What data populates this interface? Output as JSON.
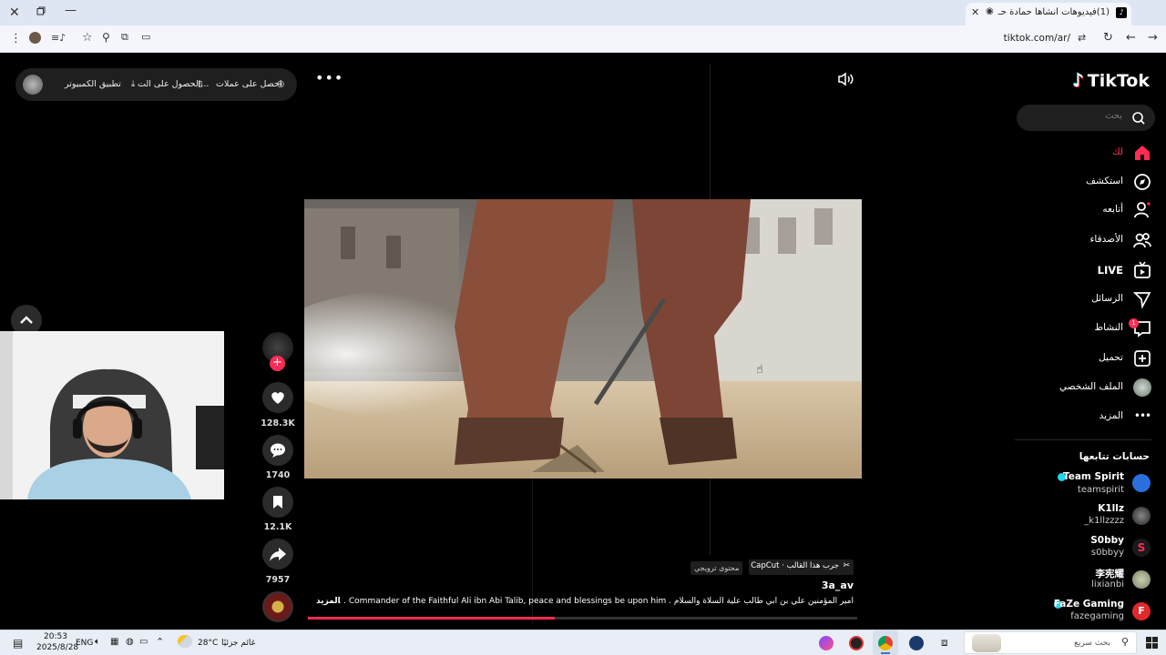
{
  "browser": {
    "tab_title": "(1)فيديوهات أنشأها حمادة حـ",
    "url": "tiktok.com/ar/"
  },
  "top_pill": {
    "coins_label": "احصل على عملات",
    "get_app_label": "الحصول على الت...",
    "desktop_app_label": "تطبيق الكمبيوتر"
  },
  "brand": {
    "name": "TikTok"
  },
  "search": {
    "placeholder": "بحث"
  },
  "nav": {
    "foryou": "لك",
    "explore": "استكشف",
    "following": "أتابعه",
    "friends": "الأصدقاء",
    "live": "LIVE",
    "messages": "الرسائل",
    "activity": "النشاط",
    "activity_badge": "1",
    "upload": "تحميل",
    "profile": "الملف الشخصي",
    "more": "المزيد"
  },
  "following_accounts": {
    "title": "حسابات تتابعها",
    "items": [
      {
        "name": "Team Spirit",
        "handle": "teamspirit"
      },
      {
        "name": "K1llz",
        "handle": "_k1llzzzz"
      },
      {
        "name": "S0bby",
        "handle": "s0bbyy"
      },
      {
        "name": "李宪耀",
        "handle": "lixianbi"
      },
      {
        "name": "FaZe Gaming",
        "handle": "fazegaming"
      }
    ]
  },
  "actions": {
    "likes": "128.3K",
    "comments": "1740",
    "saves": "12.1K",
    "shares": "7957"
  },
  "video_info": {
    "capcut_label": "CapCut · جرب هذا القالب",
    "promo_label": "محتوى ترويجي",
    "author": "3a_av",
    "caption": "أمير المؤمنين علي بن أبي طالب علية السلاة والسلام . Commander of the Faithful Ali ibn Abi Talib, peace and blessings be upon him . ...",
    "more": "المزيد",
    "progress": 0.45
  },
  "taskbar": {
    "time": "20:53",
    "date": "2025/8/28",
    "lang": "ENG",
    "weather_temp": "28°C",
    "weather_text": "غائم جزئيًا",
    "search_placeholder": "بحث سريع"
  },
  "colors": {
    "accent": "#fe2c55",
    "verified": "#20d5ec"
  }
}
